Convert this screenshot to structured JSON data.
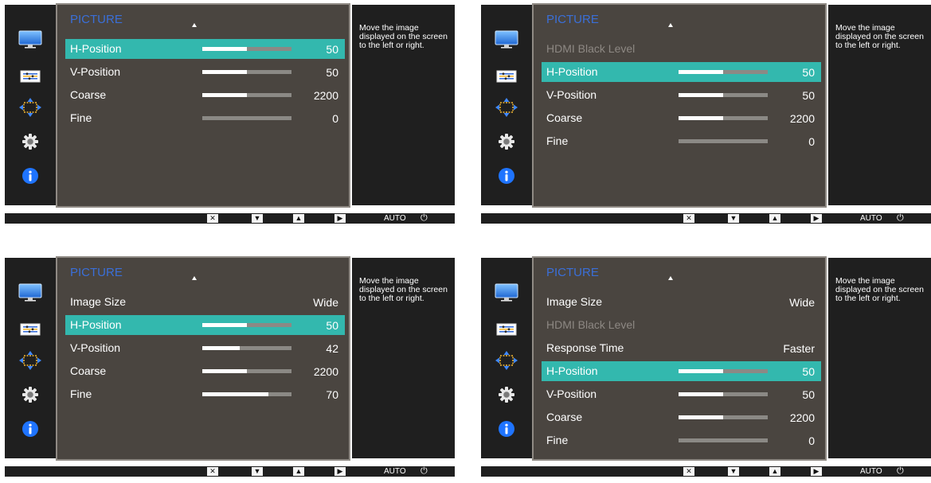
{
  "help_text": "Move the image displayed on the screen to the left or right.",
  "buttons": {
    "close": "✕",
    "down": "▼",
    "up": "▲",
    "right": "▶",
    "auto": "AUTO",
    "power": "⏻"
  },
  "panels": [
    {
      "title": "PICTURE",
      "items": [
        {
          "label": "H-Position",
          "value": "50",
          "slider": 0.5,
          "selected": true,
          "disabled": false
        },
        {
          "label": "V-Position",
          "value": "50",
          "slider": 0.5,
          "selected": false,
          "disabled": false
        },
        {
          "label": "Coarse",
          "value": "2200",
          "slider": 0.5,
          "selected": false,
          "disabled": false
        },
        {
          "label": "Fine",
          "value": "0",
          "slider": 0.0,
          "selected": false,
          "disabled": false
        }
      ]
    },
    {
      "title": "PICTURE",
      "items": [
        {
          "label": "HDMI Black Level",
          "value": "",
          "slider": null,
          "selected": false,
          "disabled": true
        },
        {
          "label": "H-Position",
          "value": "50",
          "slider": 0.5,
          "selected": true,
          "disabled": false
        },
        {
          "label": "V-Position",
          "value": "50",
          "slider": 0.5,
          "selected": false,
          "disabled": false
        },
        {
          "label": "Coarse",
          "value": "2200",
          "slider": 0.5,
          "selected": false,
          "disabled": false
        },
        {
          "label": "Fine",
          "value": "0",
          "slider": 0.0,
          "selected": false,
          "disabled": false
        }
      ]
    },
    {
      "title": "PICTURE",
      "items": [
        {
          "label": "Image Size",
          "value": "Wide",
          "slider": null,
          "selected": false,
          "disabled": false
        },
        {
          "label": "H-Position",
          "value": "50",
          "slider": 0.5,
          "selected": true,
          "disabled": false
        },
        {
          "label": "V-Position",
          "value": "42",
          "slider": 0.42,
          "selected": false,
          "disabled": false
        },
        {
          "label": "Coarse",
          "value": "2200",
          "slider": 0.5,
          "selected": false,
          "disabled": false
        },
        {
          "label": "Fine",
          "value": "70",
          "slider": 0.74,
          "selected": false,
          "disabled": false
        }
      ]
    },
    {
      "title": "PICTURE",
      "items": [
        {
          "label": "Image Size",
          "value": "Wide",
          "slider": null,
          "selected": false,
          "disabled": false
        },
        {
          "label": "HDMI Black Level",
          "value": "",
          "slider": null,
          "selected": false,
          "disabled": true
        },
        {
          "label": "Response Time",
          "value": "Faster",
          "slider": null,
          "selected": false,
          "disabled": false
        },
        {
          "label": "H-Position",
          "value": "50",
          "slider": 0.5,
          "selected": true,
          "disabled": false
        },
        {
          "label": "V-Position",
          "value": "50",
          "slider": 0.5,
          "selected": false,
          "disabled": false
        },
        {
          "label": "Coarse",
          "value": "2200",
          "slider": 0.5,
          "selected": false,
          "disabled": false
        },
        {
          "label": "Fine",
          "value": "0",
          "slider": 0.0,
          "selected": false,
          "disabled": false
        }
      ]
    }
  ],
  "icons": [
    "monitor-icon",
    "color-settings-icon",
    "position-arrows-icon",
    "gear-icon",
    "info-icon"
  ],
  "colors": {
    "selected_row": "#33b8ae",
    "title": "#3a6fd8",
    "menu_bg": "#4a4540",
    "rail_bg": "#1f1f1f",
    "slider_track": "#8b8985",
    "slider_fill": "#ffffff"
  }
}
